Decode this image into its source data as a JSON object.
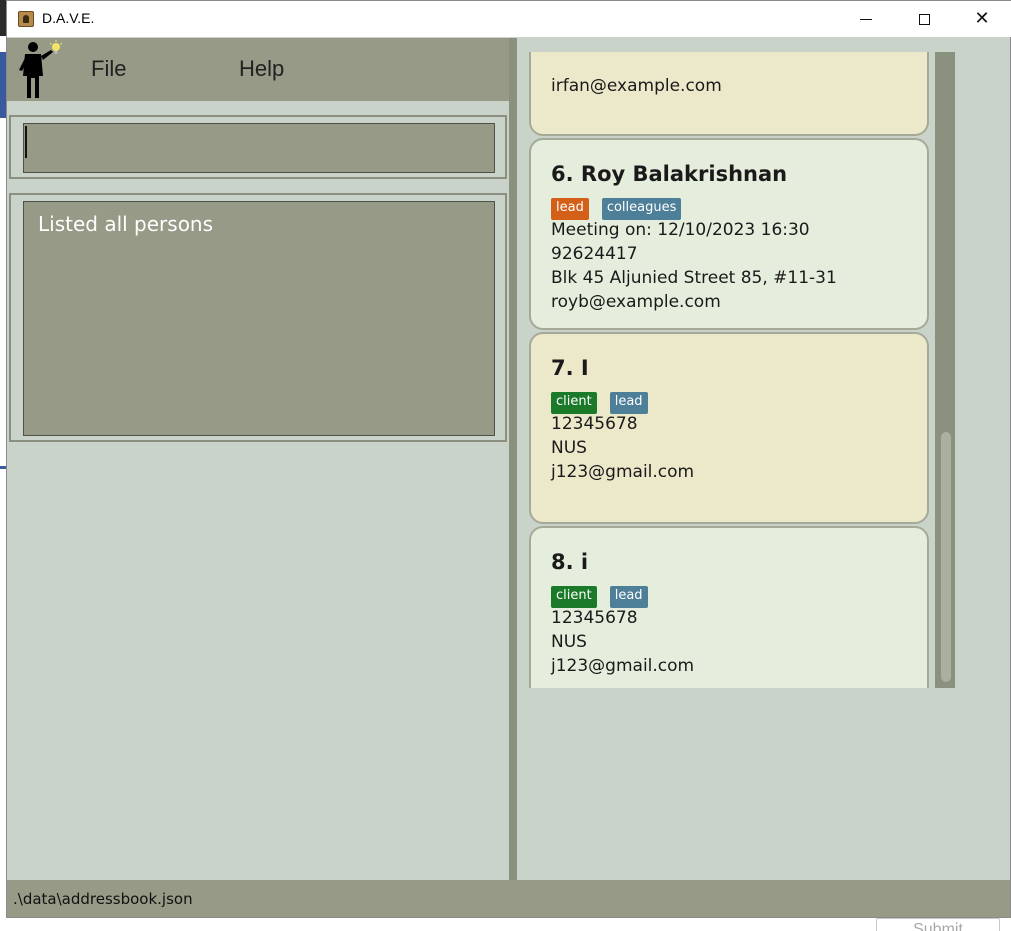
{
  "window": {
    "title": "D.A.V.E."
  },
  "menu": {
    "file": "File",
    "help": "Help"
  },
  "command": {
    "value": ""
  },
  "result": {
    "text": "Listed all persons"
  },
  "status": {
    "path": ".\\data\\addressbook.json"
  },
  "background": {
    "submit_label": "Submit"
  },
  "tag_colors": {
    "lead": "#d35f19",
    "colleagues": "#4e7f98",
    "client": "#1a7a2a"
  },
  "persons": [
    {
      "name": "",
      "tags": [],
      "lines": [
        "irfan@example.com"
      ],
      "partial": true
    },
    {
      "name": "6.  Roy Balakrishnan",
      "tags": [
        {
          "label": "lead",
          "color": "#d35f19"
        },
        {
          "label": "colleagues",
          "color": "#4e7f98"
        }
      ],
      "lines": [
        "Meeting on: 12/10/2023 16:30",
        "92624417",
        "Blk 45 Aljunied Street 85, #11-31",
        "royb@example.com"
      ]
    },
    {
      "name": "7.  I",
      "tags": [
        {
          "label": "client",
          "color": "#1a7a2a"
        },
        {
          "label": "lead",
          "color": "#4e7f98"
        }
      ],
      "lines": [
        "12345678",
        "NUS",
        "j123@gmail.com"
      ]
    },
    {
      "name": "8.  i",
      "tags": [
        {
          "label": "client",
          "color": "#1a7a2a"
        },
        {
          "label": "lead",
          "color": "#4e7f98"
        }
      ],
      "lines": [
        "12345678",
        "NUS",
        "j123@gmail.com"
      ]
    }
  ]
}
